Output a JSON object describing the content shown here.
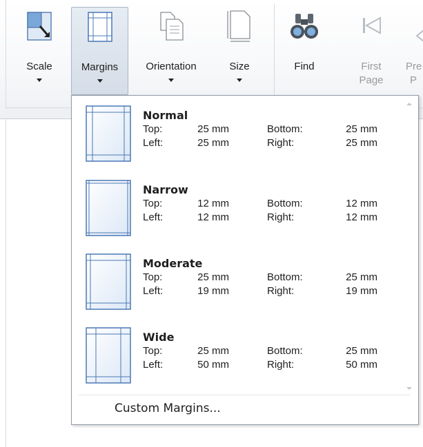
{
  "ribbon": {
    "buttons": [
      {
        "id": "scale",
        "label": "Scale",
        "icon": "scale-icon",
        "has_dropdown": true
      },
      {
        "id": "margins",
        "label": "Margins",
        "icon": "margins-icon",
        "has_dropdown": true,
        "pressed": true
      },
      {
        "id": "orientation",
        "label": "Orientation",
        "icon": "orientation-icon",
        "has_dropdown": true
      },
      {
        "id": "size",
        "label": "Size",
        "icon": "page-size-icon",
        "has_dropdown": true
      },
      {
        "id": "find",
        "label": "Find",
        "icon": "binoculars-icon"
      },
      {
        "id": "first_page",
        "label_line1": "First",
        "label_line2": "Page",
        "icon": "first-page-icon",
        "disabled": true
      },
      {
        "id": "previous_page",
        "label_line1": "Pre",
        "label_line2": "P",
        "icon": "previous-page-icon",
        "disabled": true
      }
    ]
  },
  "margins_menu": {
    "options": [
      {
        "name": "Normal",
        "top_label": "Top:",
        "top": "25 mm",
        "bottom_label": "Bottom:",
        "bottom": "25 mm",
        "left_label": "Left:",
        "left": "25 mm",
        "right_label": "Right:",
        "right": "25 mm"
      },
      {
        "name": "Narrow",
        "top_label": "Top:",
        "top": "12 mm",
        "bottom_label": "Bottom:",
        "bottom": "12 mm",
        "left_label": "Left:",
        "left": "12 mm",
        "right_label": "Right:",
        "right": "12 mm"
      },
      {
        "name": "Moderate",
        "top_label": "Top:",
        "top": "25 mm",
        "bottom_label": "Bottom:",
        "bottom": "25 mm",
        "left_label": "Left:",
        "left": "19 mm",
        "right_label": "Right:",
        "right": "19 mm"
      },
      {
        "name": "Wide",
        "top_label": "Top:",
        "top": "25 mm",
        "bottom_label": "Bottom:",
        "bottom": "25 mm",
        "left_label": "Left:",
        "left": "50 mm",
        "right_label": "Right:",
        "right": "50 mm"
      }
    ],
    "custom_label": "Custom Margins..."
  },
  "colors": {
    "accent_blue": "#4a78b5",
    "menu_border": "#8f9aa8",
    "disabled_text": "#9a9a9a"
  }
}
